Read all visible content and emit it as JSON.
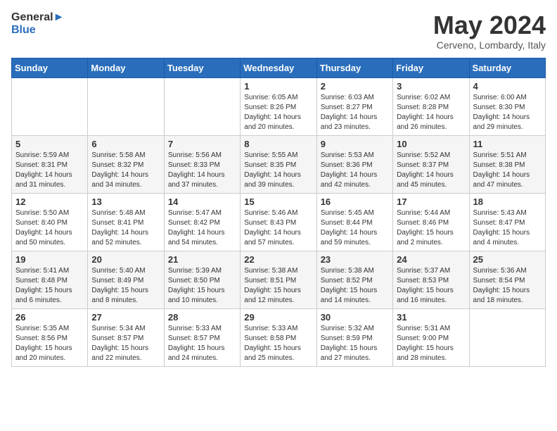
{
  "logo": {
    "general": "General",
    "blue": "Blue"
  },
  "header": {
    "month": "May 2024",
    "location": "Cerveno, Lombardy, Italy"
  },
  "weekdays": [
    "Sunday",
    "Monday",
    "Tuesday",
    "Wednesday",
    "Thursday",
    "Friday",
    "Saturday"
  ],
  "weeks": [
    [
      {
        "day": "",
        "sunrise": "",
        "sunset": "",
        "daylight": ""
      },
      {
        "day": "",
        "sunrise": "",
        "sunset": "",
        "daylight": ""
      },
      {
        "day": "",
        "sunrise": "",
        "sunset": "",
        "daylight": ""
      },
      {
        "day": "1",
        "sunrise": "Sunrise: 6:05 AM",
        "sunset": "Sunset: 8:26 PM",
        "daylight": "Daylight: 14 hours and 20 minutes."
      },
      {
        "day": "2",
        "sunrise": "Sunrise: 6:03 AM",
        "sunset": "Sunset: 8:27 PM",
        "daylight": "Daylight: 14 hours and 23 minutes."
      },
      {
        "day": "3",
        "sunrise": "Sunrise: 6:02 AM",
        "sunset": "Sunset: 8:28 PM",
        "daylight": "Daylight: 14 hours and 26 minutes."
      },
      {
        "day": "4",
        "sunrise": "Sunrise: 6:00 AM",
        "sunset": "Sunset: 8:30 PM",
        "daylight": "Daylight: 14 hours and 29 minutes."
      }
    ],
    [
      {
        "day": "5",
        "sunrise": "Sunrise: 5:59 AM",
        "sunset": "Sunset: 8:31 PM",
        "daylight": "Daylight: 14 hours and 31 minutes."
      },
      {
        "day": "6",
        "sunrise": "Sunrise: 5:58 AM",
        "sunset": "Sunset: 8:32 PM",
        "daylight": "Daylight: 14 hours and 34 minutes."
      },
      {
        "day": "7",
        "sunrise": "Sunrise: 5:56 AM",
        "sunset": "Sunset: 8:33 PM",
        "daylight": "Daylight: 14 hours and 37 minutes."
      },
      {
        "day": "8",
        "sunrise": "Sunrise: 5:55 AM",
        "sunset": "Sunset: 8:35 PM",
        "daylight": "Daylight: 14 hours and 39 minutes."
      },
      {
        "day": "9",
        "sunrise": "Sunrise: 5:53 AM",
        "sunset": "Sunset: 8:36 PM",
        "daylight": "Daylight: 14 hours and 42 minutes."
      },
      {
        "day": "10",
        "sunrise": "Sunrise: 5:52 AM",
        "sunset": "Sunset: 8:37 PM",
        "daylight": "Daylight: 14 hours and 45 minutes."
      },
      {
        "day": "11",
        "sunrise": "Sunrise: 5:51 AM",
        "sunset": "Sunset: 8:38 PM",
        "daylight": "Daylight: 14 hours and 47 minutes."
      }
    ],
    [
      {
        "day": "12",
        "sunrise": "Sunrise: 5:50 AM",
        "sunset": "Sunset: 8:40 PM",
        "daylight": "Daylight: 14 hours and 50 minutes."
      },
      {
        "day": "13",
        "sunrise": "Sunrise: 5:48 AM",
        "sunset": "Sunset: 8:41 PM",
        "daylight": "Daylight: 14 hours and 52 minutes."
      },
      {
        "day": "14",
        "sunrise": "Sunrise: 5:47 AM",
        "sunset": "Sunset: 8:42 PM",
        "daylight": "Daylight: 14 hours and 54 minutes."
      },
      {
        "day": "15",
        "sunrise": "Sunrise: 5:46 AM",
        "sunset": "Sunset: 8:43 PM",
        "daylight": "Daylight: 14 hours and 57 minutes."
      },
      {
        "day": "16",
        "sunrise": "Sunrise: 5:45 AM",
        "sunset": "Sunset: 8:44 PM",
        "daylight": "Daylight: 14 hours and 59 minutes."
      },
      {
        "day": "17",
        "sunrise": "Sunrise: 5:44 AM",
        "sunset": "Sunset: 8:46 PM",
        "daylight": "Daylight: 15 hours and 2 minutes."
      },
      {
        "day": "18",
        "sunrise": "Sunrise: 5:43 AM",
        "sunset": "Sunset: 8:47 PM",
        "daylight": "Daylight: 15 hours and 4 minutes."
      }
    ],
    [
      {
        "day": "19",
        "sunrise": "Sunrise: 5:41 AM",
        "sunset": "Sunset: 8:48 PM",
        "daylight": "Daylight: 15 hours and 6 minutes."
      },
      {
        "day": "20",
        "sunrise": "Sunrise: 5:40 AM",
        "sunset": "Sunset: 8:49 PM",
        "daylight": "Daylight: 15 hours and 8 minutes."
      },
      {
        "day": "21",
        "sunrise": "Sunrise: 5:39 AM",
        "sunset": "Sunset: 8:50 PM",
        "daylight": "Daylight: 15 hours and 10 minutes."
      },
      {
        "day": "22",
        "sunrise": "Sunrise: 5:38 AM",
        "sunset": "Sunset: 8:51 PM",
        "daylight": "Daylight: 15 hours and 12 minutes."
      },
      {
        "day": "23",
        "sunrise": "Sunrise: 5:38 AM",
        "sunset": "Sunset: 8:52 PM",
        "daylight": "Daylight: 15 hours and 14 minutes."
      },
      {
        "day": "24",
        "sunrise": "Sunrise: 5:37 AM",
        "sunset": "Sunset: 8:53 PM",
        "daylight": "Daylight: 15 hours and 16 minutes."
      },
      {
        "day": "25",
        "sunrise": "Sunrise: 5:36 AM",
        "sunset": "Sunset: 8:54 PM",
        "daylight": "Daylight: 15 hours and 18 minutes."
      }
    ],
    [
      {
        "day": "26",
        "sunrise": "Sunrise: 5:35 AM",
        "sunset": "Sunset: 8:56 PM",
        "daylight": "Daylight: 15 hours and 20 minutes."
      },
      {
        "day": "27",
        "sunrise": "Sunrise: 5:34 AM",
        "sunset": "Sunset: 8:57 PM",
        "daylight": "Daylight: 15 hours and 22 minutes."
      },
      {
        "day": "28",
        "sunrise": "Sunrise: 5:33 AM",
        "sunset": "Sunset: 8:57 PM",
        "daylight": "Daylight: 15 hours and 24 minutes."
      },
      {
        "day": "29",
        "sunrise": "Sunrise: 5:33 AM",
        "sunset": "Sunset: 8:58 PM",
        "daylight": "Daylight: 15 hours and 25 minutes."
      },
      {
        "day": "30",
        "sunrise": "Sunrise: 5:32 AM",
        "sunset": "Sunset: 8:59 PM",
        "daylight": "Daylight: 15 hours and 27 minutes."
      },
      {
        "day": "31",
        "sunrise": "Sunrise: 5:31 AM",
        "sunset": "Sunset: 9:00 PM",
        "daylight": "Daylight: 15 hours and 28 minutes."
      },
      {
        "day": "",
        "sunrise": "",
        "sunset": "",
        "daylight": ""
      }
    ]
  ]
}
